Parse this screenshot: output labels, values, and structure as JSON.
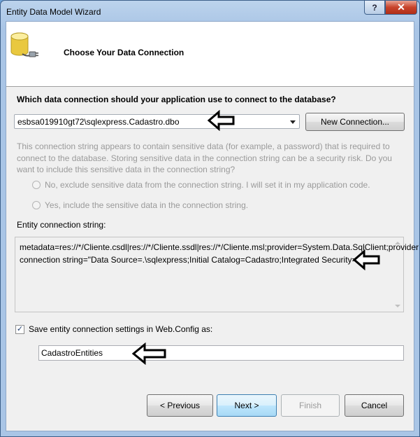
{
  "window": {
    "title": "Entity Data Model Wizard",
    "help_label": "?",
    "close_label": "✕"
  },
  "header": {
    "title": "Choose Your Data Connection",
    "icon": "database-connection-icon"
  },
  "connection": {
    "question": "Which data connection should your application use to connect to the database?",
    "selected": "esbsa019910gt72\\sqlexpress.Cadastro.dbo",
    "new_connection_label": "New Connection..."
  },
  "sensitive": {
    "description": "This connection string appears to contain sensitive data (for example, a password) that is required to connect to the database. Storing sensitive data in the connection string can be a security risk. Do you want to include this sensitive data in the connection string?",
    "option_exclude": "No, exclude sensitive data from the connection string. I will set it in my application code.",
    "option_include": "Yes, include the sensitive data in the connection string."
  },
  "entity_connection": {
    "label": "Entity connection string:",
    "value": "metadata=res://*/Cliente.csdl|res://*/Cliente.ssdl|res://*/Cliente.msl;provider=System.Data.SqlClient;provider connection string=\"Data Source=.\\sqlexpress;Initial Catalog=Cadastro;Integrated Security=True\""
  },
  "save_settings": {
    "checked": true,
    "label": "Save entity connection settings in Web.Config as:",
    "name_value": "CadastroEntities"
  },
  "footer": {
    "previous_label": "< Previous",
    "next_label": "Next >",
    "finish_label": "Finish",
    "cancel_label": "Cancel"
  },
  "annotation_arrows": [
    "left-arrow-icon",
    "left-arrow-icon",
    "left-arrow-icon"
  ]
}
